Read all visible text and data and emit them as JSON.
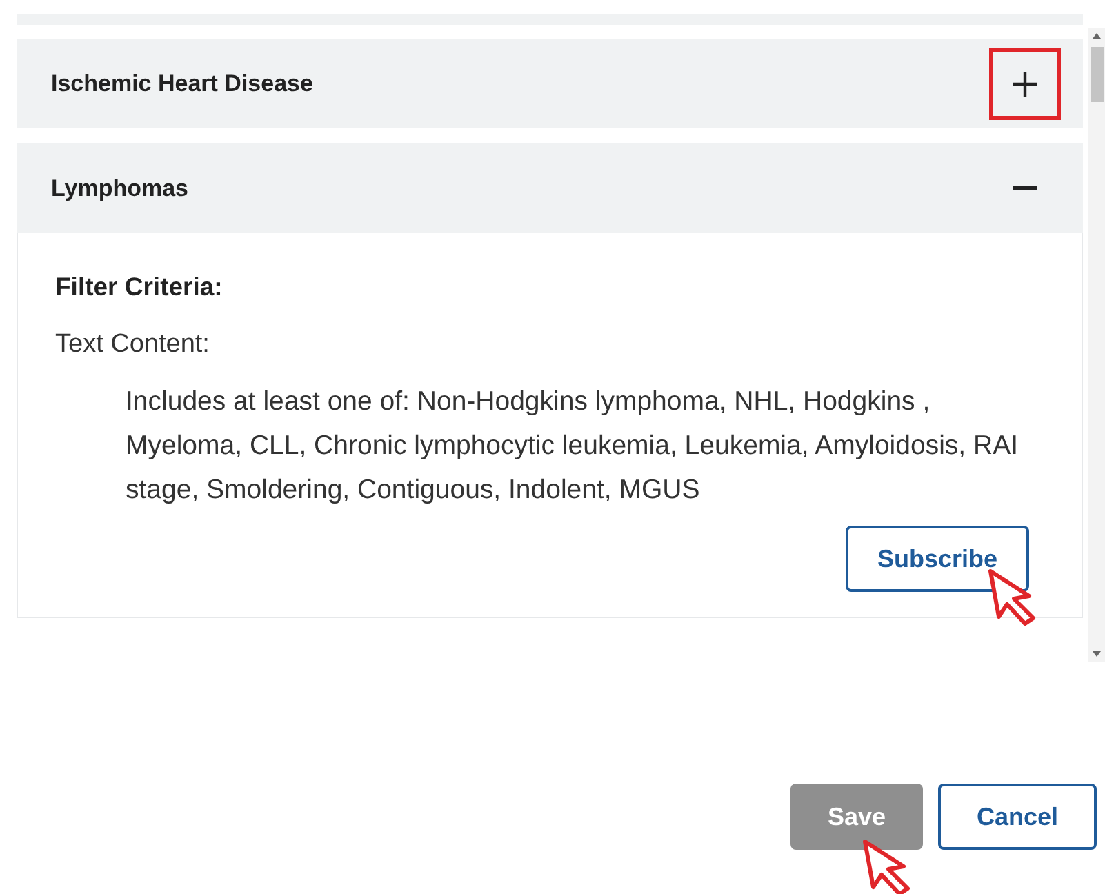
{
  "sections": [
    {
      "title": "Ischemic Heart Disease",
      "expanded": false,
      "highlighted": true
    },
    {
      "title": "Lymphomas",
      "expanded": true,
      "highlighted": false,
      "body": {
        "heading": "Filter Criteria:",
        "label": "Text Content:",
        "criteria": "Includes at least one of: Non-Hodgkins lymphoma, NHL, Hodgkins , Myeloma, CLL, Chronic lymphocytic leukemia, Leukemia, Amyloidosis, RAI stage, Smoldering, Contiguous, Indolent, MGUS",
        "button": "Subscribe"
      }
    }
  ],
  "actions": [
    {
      "label": "Save",
      "disabled": true
    },
    {
      "label": "Cancel",
      "disabled": false
    }
  ]
}
